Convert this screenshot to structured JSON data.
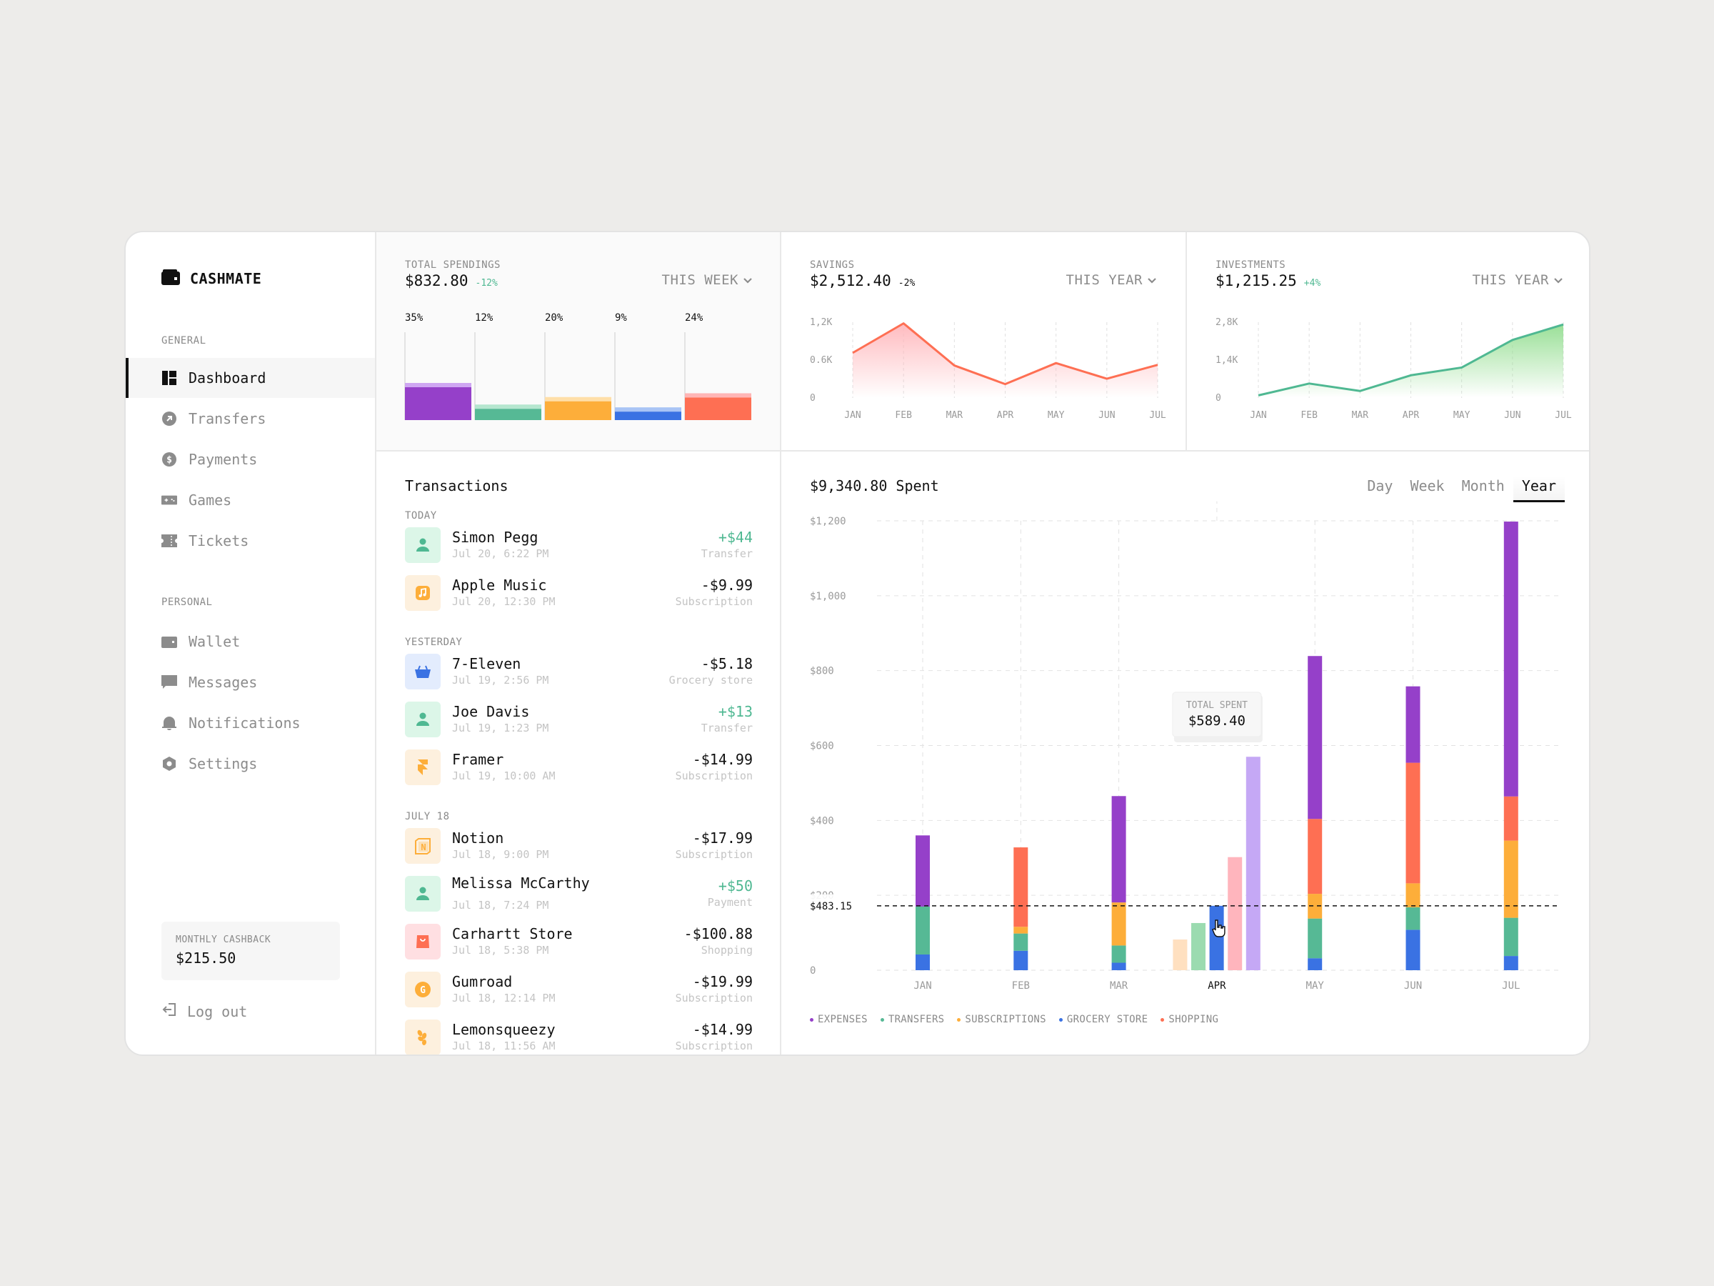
{
  "app": {
    "name": "CASHMATE",
    "logo_icon": "wallet-icon"
  },
  "sidebar": {
    "general_label": "GENERAL",
    "personal_label": "PERSONAL",
    "general_items": [
      {
        "label": "Dashboard",
        "icon": "dashboard-icon",
        "active": true
      },
      {
        "label": "Transfers",
        "icon": "transfer-arrow-icon"
      },
      {
        "label": "Payments",
        "icon": "dollar-icon"
      },
      {
        "label": "Games",
        "icon": "gamepad-icon"
      },
      {
        "label": "Tickets",
        "icon": "ticket-icon"
      }
    ],
    "personal_items": [
      {
        "label": "Wallet",
        "icon": "wallet-icon"
      },
      {
        "label": "Messages",
        "icon": "message-icon"
      },
      {
        "label": "Notifications",
        "icon": "bell-icon"
      },
      {
        "label": "Settings",
        "icon": "gear-icon"
      }
    ],
    "cashback": {
      "label": "MONTHLY CASHBACK",
      "value": "$215.50"
    },
    "logout_label": "Log out"
  },
  "cards": {
    "spendings": {
      "title": "TOTAL SPENDINGS",
      "amount": "$832.80",
      "delta": "-12%",
      "period": "THIS WEEK",
      "bars": [
        {
          "label": "35%",
          "value": 35,
          "color": "#9540c9",
          "light": "#cfa6f2"
        },
        {
          "label": "12%",
          "value": 12,
          "color": "#56b995",
          "light": "#b5e6cf"
        },
        {
          "label": "20%",
          "value": 20,
          "color": "#fdae3a",
          "light": "#ffdfa8"
        },
        {
          "label": "9%",
          "value": 9,
          "color": "#3a72e3",
          "light": "#a9c4f5"
        },
        {
          "label": "24%",
          "value": 24,
          "color": "#fe6f53",
          "light": "#ffb5b5"
        }
      ]
    },
    "savings": {
      "title": "SAVINGS",
      "amount": "$2,512.40",
      "delta": "-2%",
      "period": "THIS YEAR",
      "y_ticks": [
        "1,2K",
        "0.6K",
        "0"
      ],
      "x": [
        "JAN",
        "FEB",
        "MAR",
        "APR",
        "MAY",
        "JUN",
        "JUL"
      ],
      "values": [
        750,
        1240,
        540,
        230,
        580,
        320,
        550
      ],
      "ymax": 1200,
      "color": "#fe6f53"
    },
    "investments": {
      "title": "INVESTMENTS",
      "amount": "$1,215.25",
      "delta": "+4%",
      "period": "THIS YEAR",
      "y_ticks": [
        "2,8K",
        "1,4K",
        "0"
      ],
      "x": [
        "JAN",
        "FEB",
        "MAR",
        "APR",
        "MAY",
        "JUN",
        "JUL"
      ],
      "values": [
        100,
        560,
        270,
        880,
        1180,
        2250,
        2850
      ],
      "ymax": 2800,
      "color": "#4fb892"
    }
  },
  "transactions": {
    "title": "Transactions",
    "groups": [
      {
        "label": "TODAY",
        "items": [
          {
            "name": "Simon Pegg",
            "date": "Jul 20, 6:22 PM",
            "amount": "+$44",
            "category": "Transfer",
            "positive": true,
            "icon": "user-icon",
            "bg": "#dcf6e8",
            "fg": "#4fb892"
          },
          {
            "name": "Apple Music",
            "date": "Jul 20, 12:30 PM",
            "amount": "-$9.99",
            "category": "Subscription",
            "icon": "music-note-icon",
            "bg": "#fdf0de",
            "fg": "#fdae3a"
          }
        ]
      },
      {
        "label": "YESTERDAY",
        "items": [
          {
            "name": "7-Eleven",
            "date": "Jul 19, 2:56 PM",
            "amount": "-$5.18",
            "category": "Grocery store",
            "icon": "basket-icon",
            "bg": "#e3ecfd",
            "fg": "#3a72e3"
          },
          {
            "name": "Joe Davis",
            "date": "Jul 19, 1:23 PM",
            "amount": "+$13",
            "category": "Transfer",
            "positive": true,
            "icon": "user-icon",
            "bg": "#dcf6e8",
            "fg": "#4fb892"
          },
          {
            "name": "Framer",
            "date": "Jul 19, 10:00 AM",
            "amount": "-$14.99",
            "category": "Subscription",
            "icon": "framer-icon",
            "bg": "#fdf0de",
            "fg": "#fdae3a"
          }
        ]
      },
      {
        "label": "JULY 18",
        "items": [
          {
            "name": "Notion",
            "date": "Jul 18, 9:00 PM",
            "amount": "-$17.99",
            "category": "Subscription",
            "icon": "notion-icon",
            "bg": "#fdf0de",
            "fg": "#fdae3a"
          },
          {
            "name": "Melissa McCarthy",
            "date": "Jul 18, 7:24 PM",
            "amount": "+$50",
            "category": "Payment",
            "positive": true,
            "icon": "user-icon",
            "bg": "#dcf6e8",
            "fg": "#4fb892"
          },
          {
            "name": "Carhartt Store",
            "date": "Jul 18, 5:38 PM",
            "amount": "-$100.88",
            "category": "Shopping",
            "icon": "shopping-bag-icon",
            "bg": "#ffdfe2",
            "fg": "#fe6f53"
          },
          {
            "name": "Gumroad",
            "date": "Jul 18, 12:14 PM",
            "amount": "-$19.99",
            "category": "Subscription",
            "icon": "gumroad-icon",
            "bg": "#fdf0de",
            "fg": "#fdae3a"
          },
          {
            "name": "Lemonsqueezy",
            "date": "Jul 18, 11:56 AM",
            "amount": "-$14.99",
            "category": "Subscription",
            "icon": "lemon-icon",
            "bg": "#fdf0de",
            "fg": "#fdae3a"
          }
        ]
      }
    ]
  },
  "main_chart": {
    "title": "$9,340.80 Spent",
    "tabs": [
      {
        "label": "Day"
      },
      {
        "label": "Week"
      },
      {
        "label": "Month"
      },
      {
        "label": "Year",
        "active": true
      }
    ],
    "tooltip": {
      "label": "TOTAL SPENT",
      "value": "$589.40"
    },
    "average_line": {
      "label": "$483.15",
      "value": 172
    }
  },
  "chart_data": {
    "type": "bar",
    "stacked": true,
    "title": "$9,340.80 Spent",
    "xlabel": "",
    "ylabel": "",
    "ylim": [
      0,
      1200
    ],
    "y_ticks": [
      "$1,200",
      "$1,000",
      "$800",
      "$600",
      "$400",
      "$200",
      "0"
    ],
    "y_tick_values": [
      1200,
      1000,
      800,
      600,
      400,
      200,
      0
    ],
    "categories": [
      "JAN",
      "FEB",
      "MAR",
      "APR",
      "MAY",
      "JUN",
      "JUL"
    ],
    "highlighted_category": "APR",
    "grid": true,
    "legend_position": "bottom-left",
    "series": [
      {
        "name": "GROCERY STORE",
        "color": "#3a72e3",
        "light": "#3a72e3",
        "values": [
          42,
          52,
          20,
          172,
          32,
          108,
          38
        ]
      },
      {
        "name": "TRANSFERS",
        "color": "#56b995",
        "light": "#9bdbb0",
        "values": [
          128,
          46,
          46,
          126,
          106,
          60,
          102
        ]
      },
      {
        "name": "SUBSCRIPTIONS",
        "color": "#fdae3a",
        "light": "#ffe0c0",
        "values": [
          0,
          18,
          115,
          82,
          66,
          64,
          206
        ]
      },
      {
        "name": "SHOPPING",
        "color": "#fe6f53",
        "light": "#ffb5bd",
        "values": [
          0,
          212,
          0,
          302,
          200,
          322,
          118
        ]
      },
      {
        "name": "EXPENSES",
        "color": "#9540c9",
        "light": "#c5a8f5",
        "values": [
          190,
          0,
          284,
          570,
          435,
          204,
          734
        ]
      }
    ],
    "legend": [
      "EXPENSES",
      "TRANSFERS",
      "SUBSCRIPTIONS",
      "GROCERY STORE",
      "SHOPPING"
    ],
    "legend_colors": [
      "#9540c9",
      "#56b995",
      "#fdae3a",
      "#3a72e3",
      "#fe6f53"
    ],
    "average": 172,
    "average_label": "$483.15",
    "tooltip_total": "$589.40"
  }
}
